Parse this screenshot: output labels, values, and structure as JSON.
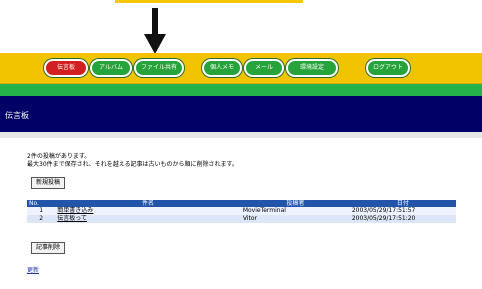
{
  "nav": {
    "buttons": [
      {
        "label": "伝言板",
        "color": "#d21f1f"
      },
      {
        "label": "アルバム",
        "color": "#26a33a"
      },
      {
        "label": "ファイル共有",
        "color": "#26a33a"
      },
      {
        "label": "個人メモ",
        "color": "#26a33a"
      },
      {
        "label": "メール",
        "color": "#26a33a"
      },
      {
        "label": "環境設定",
        "color": "#26a33a"
      },
      {
        "label": "ログアウト",
        "color": "#26a33a"
      }
    ]
  },
  "header": {
    "title": "伝言板"
  },
  "messages": {
    "line1": "2件の投稿があります。",
    "line2": "最大30件まで保存され、それを越える記事は古いものから順に削除されます。"
  },
  "actions": {
    "new_post": "新規投稿",
    "delete_post": "記事削除",
    "refresh": "更新"
  },
  "table": {
    "columns": [
      "No.",
      "件名",
      "投稿者",
      "日付"
    ],
    "rows": [
      {
        "no": "1",
        "subject": "簡単書き込み",
        "author": "MovieTerminal",
        "date": "2003/05/29/17:51:57"
      },
      {
        "no": "2",
        "subject": "伝言板って",
        "author": "Vitor",
        "date": "2003/05/29/17:51:20"
      }
    ]
  },
  "colors": {
    "nav_bg": "#f2c400",
    "header_bg": "#000066",
    "accent_green": "#25b24a",
    "table_header": "#2255aa"
  }
}
